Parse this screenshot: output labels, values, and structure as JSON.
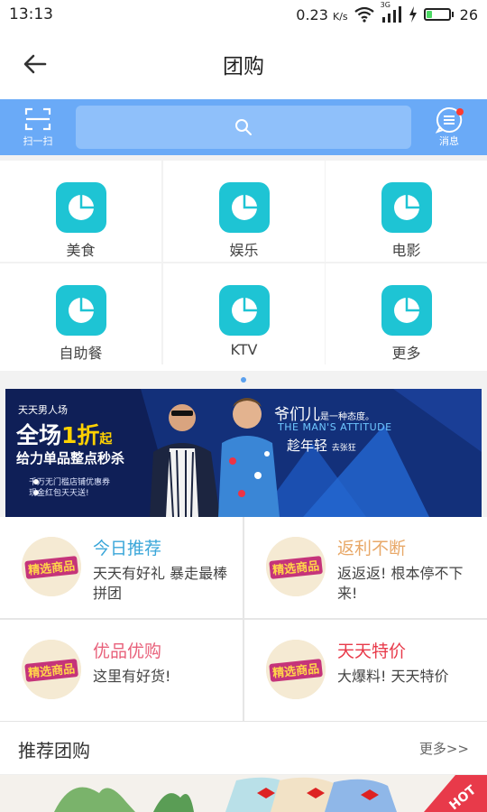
{
  "status_bar": {
    "time": "13:13",
    "network_speed": "0.23",
    "speed_unit": "K/s",
    "battery_level": "26",
    "battery_fraction": 0.26,
    "network_type": "3G"
  },
  "header": {
    "title": "团购",
    "back_icon": "arrow-left-icon"
  },
  "search_bar": {
    "scan_label": "扫一扫",
    "message_label": "消息",
    "search_icon": "search-icon",
    "has_unread": true
  },
  "categories": [
    {
      "label": "美食",
      "icon": "pie-chart-icon"
    },
    {
      "label": "娱乐",
      "icon": "pie-chart-icon"
    },
    {
      "label": "电影",
      "icon": "pie-chart-icon"
    },
    {
      "label": "自助餐",
      "icon": "pie-chart-icon"
    },
    {
      "label": "KTV",
      "icon": "pie-chart-icon"
    },
    {
      "label": "更多",
      "icon": "pie-chart-icon"
    }
  ],
  "banner": {
    "tag": "天天男人场",
    "headline_a": "全场",
    "headline_b": "1折",
    "headline_c": "起",
    "subline": "给力单品整点秒杀",
    "note_1": "千万无门槛店铺优惠券",
    "note_2": "现金红包天天送!",
    "slogan_a": "爷们儿",
    "slogan_b": "是一种态度。",
    "slogan_en": "THE MAN'S ATTITUDE",
    "slogan_c": "趁年轻",
    "slogan_d": "去张狂"
  },
  "promos": [
    {
      "title": "今日推荐",
      "desc": "天天有好礼 暴走最棒拼团",
      "color": "#3aa6d9",
      "badge_text": "精选商品"
    },
    {
      "title": "返利不断",
      "desc": "返返返! 根本停不下来!",
      "color": "#e8a868",
      "badge_text": "精选商品"
    },
    {
      "title": "优品优购",
      "desc": "这里有好货!",
      "color": "#e8607a",
      "badge_text": "精选商品"
    },
    {
      "title": "天天特价",
      "desc": "大爆料! 天天特价",
      "color": "#e83a4a",
      "badge_text": "精选商品"
    }
  ],
  "recommend": {
    "title": "推荐团购",
    "more_label": "更多>>",
    "hot_label": "HOT"
  },
  "colors": {
    "accent_blue": "#6aaaf7",
    "category_icon_bg": "#1ec4d4",
    "banner_bg": "#0f1f57"
  }
}
